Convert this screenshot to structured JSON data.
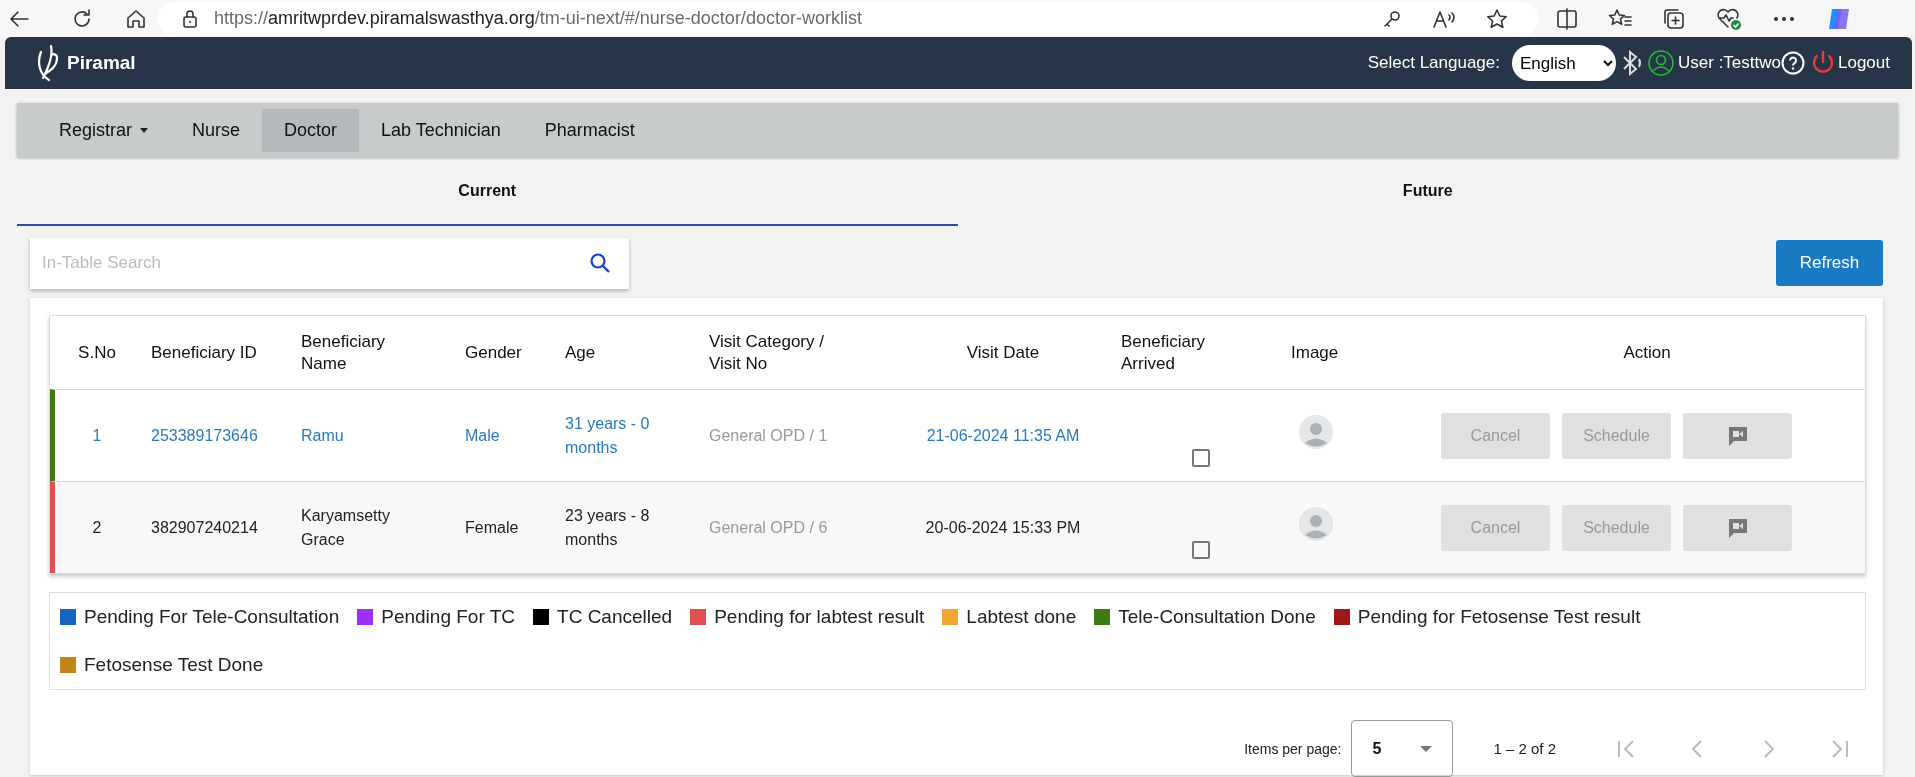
{
  "browser": {
    "url": {
      "scheme": "https://",
      "host": "amritwprdev.piramalswasthya.org",
      "path": "/tm-ui-next/#/nurse-doctor/doctor-worklist"
    }
  },
  "header": {
    "logo": "Piramal",
    "language_label": "Select Language:",
    "language": "English",
    "user": "User :Testtwo",
    "logout": "Logout"
  },
  "nav": [
    {
      "label": "Registrar",
      "dropdown": true,
      "selected": false
    },
    {
      "label": "Nurse",
      "dropdown": false,
      "selected": false
    },
    {
      "label": "Doctor",
      "dropdown": false,
      "selected": true
    },
    {
      "label": "Lab Technician",
      "dropdown": false,
      "selected": false
    },
    {
      "label": "Pharmacist",
      "dropdown": false,
      "selected": false
    }
  ],
  "tabs": [
    {
      "label": "Current",
      "selected": true
    },
    {
      "label": "Future",
      "selected": false
    }
  ],
  "search": {
    "placeholder": "In-Table Search"
  },
  "refresh": "Refresh",
  "table": {
    "columns": [
      "S.No",
      "Beneficiary ID",
      "Beneficiary Name",
      "Gender",
      "Age",
      "Visit Category / Visit No",
      "Visit Date",
      "Beneficiary Arrived",
      "Image",
      "Action"
    ],
    "rows": [
      {
        "color": "#3d7a14",
        "highlighted": true,
        "cells": [
          "1",
          "253389173646",
          "Ramu",
          "Male",
          "31 years - 0 months",
          "General OPD / 1",
          "21-06-2024 11:35 AM"
        ],
        "arrived": false,
        "actions": [
          {
            "kind": "text",
            "label": "Cancel",
            "disabled": true
          },
          {
            "kind": "text",
            "label": "Schedule",
            "disabled": true
          },
          {
            "kind": "video",
            "disabled": true
          }
        ]
      },
      {
        "color": "#e05050",
        "highlighted": false,
        "cells": [
          "2",
          "382907240214",
          "Karyamsetty Grace",
          "Female",
          "23 years - 8 months",
          "General OPD / 6",
          "20-06-2024 15:33 PM"
        ],
        "arrived": false,
        "actions": [
          {
            "kind": "text",
            "label": "Cancel",
            "disabled": true
          },
          {
            "kind": "text",
            "label": "Schedule",
            "disabled": true
          },
          {
            "kind": "video",
            "disabled": true
          }
        ]
      }
    ]
  },
  "legend": [
    {
      "label": "Pending For Tele-Consultation",
      "color": "#1565c0"
    },
    {
      "label": "Pending For TC",
      "color": "#9b30ff"
    },
    {
      "label": "TC Cancelled",
      "color": "#000000"
    },
    {
      "label": "Pending for labtest result",
      "color": "#e05050"
    },
    {
      "label": "Labtest done",
      "color": "#f0a830"
    },
    {
      "label": "Tele-Consultation Done",
      "color": "#3d7a14"
    },
    {
      "label": "Pending for Fetosense Test result",
      "color": "#a01818"
    },
    {
      "label": "Fetosense Test Done",
      "color": "#c08418"
    }
  ],
  "pagination": {
    "label": "Items per page:",
    "page_size": "5",
    "range": "1 – 2 of 2",
    "buttons": [
      {
        "kind": "first",
        "disabled": true
      },
      {
        "kind": "previous",
        "disabled": true
      },
      {
        "kind": "next",
        "disabled": true
      },
      {
        "kind": "last",
        "disabled": true
      }
    ]
  }
}
